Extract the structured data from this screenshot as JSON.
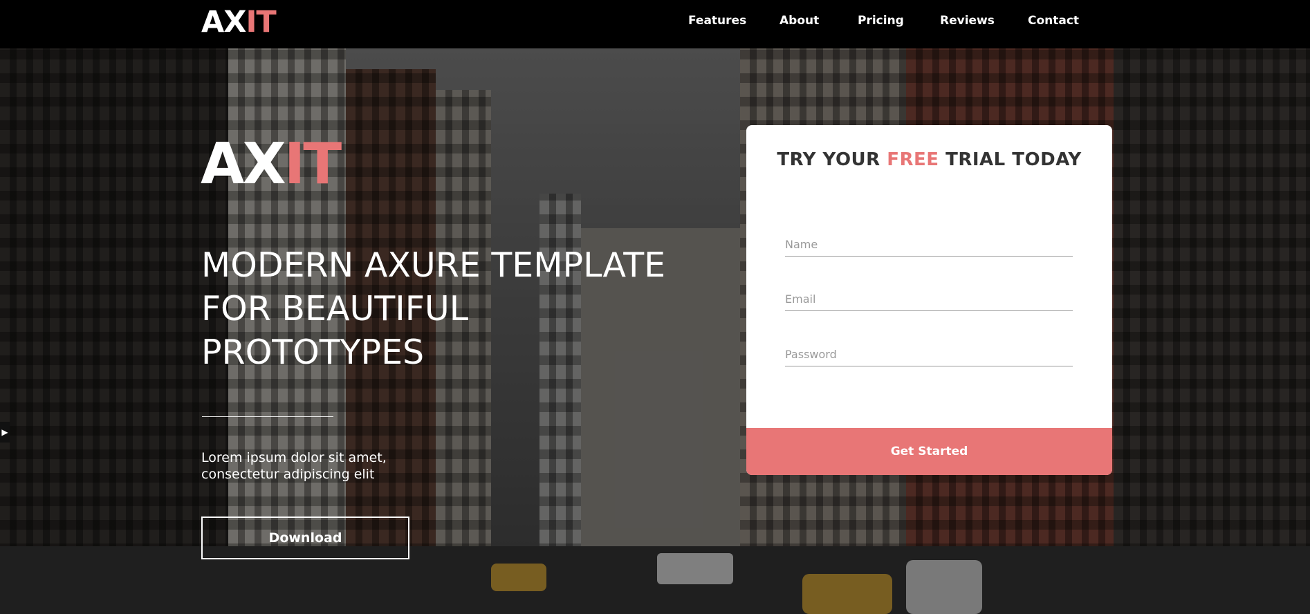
{
  "nav": {
    "logo": {
      "part1": "AX",
      "part2": "IT"
    },
    "links": [
      "Features",
      "About",
      "Pricing",
      "Reviews",
      "Contact"
    ]
  },
  "hero": {
    "logo": {
      "part1": "AX",
      "part2": "IT"
    },
    "headline": [
      "MODERN AXURE TEMPLATE",
      "FOR BEAUTIFUL",
      "PROTOTYPES"
    ],
    "subtext": [
      "Lorem ipsum dolor sit amet,",
      "consectetur adipiscing elit"
    ],
    "download_label": "Download"
  },
  "form": {
    "title": {
      "before": "TRY YOUR ",
      "accent": "FREE",
      "after": " TRIAL TODAY"
    },
    "name_placeholder": "Name",
    "email_placeholder": "Email",
    "password_placeholder": "Password",
    "submit_label": "Get Started"
  },
  "colors": {
    "accent": "#e87676",
    "nav_bg": "#000000"
  },
  "icons": {
    "side_tab": "play-icon"
  }
}
